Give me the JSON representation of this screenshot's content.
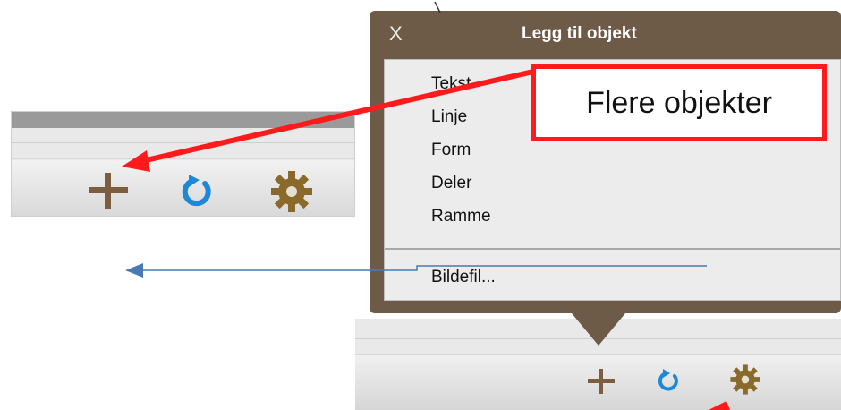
{
  "popover": {
    "close_label": "X",
    "title": "Legg til objekt",
    "items": [
      "Tekst",
      "Linje",
      "Form",
      "Deler",
      "Ramme"
    ],
    "file_item": "Bildefil..."
  },
  "callout": {
    "label": "Flere objekter"
  },
  "toolbar": {
    "add_icon": "plus-icon",
    "refresh_icon": "refresh-icon",
    "settings_icon": "gear-icon"
  },
  "colors": {
    "popover_bg": "#6d5a47",
    "annotation_red": "#ff1b1b",
    "annotation_blue": "#4a78b4",
    "icon_brown": "#7b5e3f",
    "icon_blue": "#1e88d8",
    "gear_brown": "#8a6a2a"
  }
}
